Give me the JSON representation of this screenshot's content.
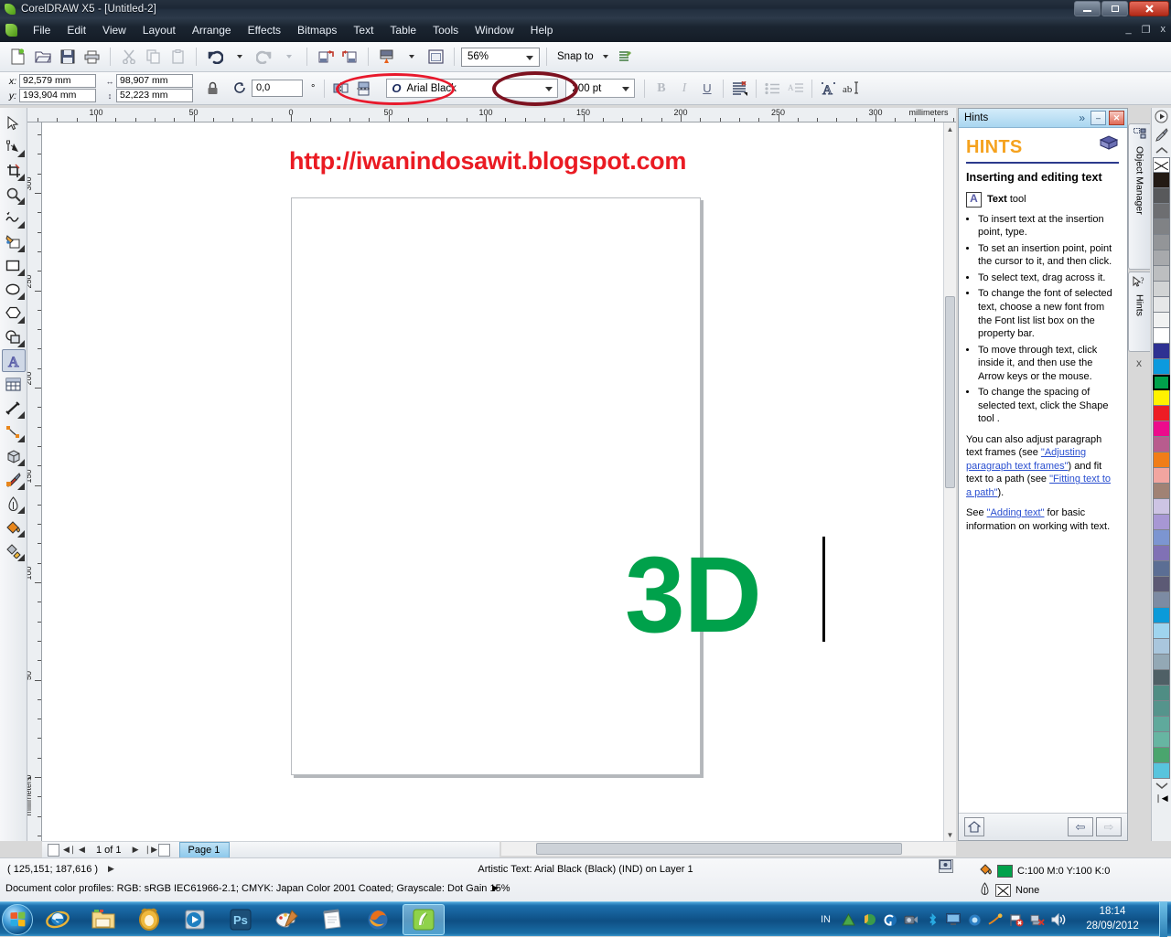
{
  "window": {
    "title": "CorelDRAW X5 - [Untitled-2]",
    "app_icon": "coreldraw-icon",
    "minimize": "minimize-icon",
    "maximize": "maximize-icon",
    "close": "close-icon"
  },
  "menu": {
    "items": [
      "File",
      "Edit",
      "View",
      "Layout",
      "Arrange",
      "Effects",
      "Bitmaps",
      "Text",
      "Table",
      "Tools",
      "Window",
      "Help"
    ],
    "doc_minimize": "_",
    "doc_restore": "❐",
    "doc_close": "x"
  },
  "toolbar": {
    "buttons": [
      {
        "name": "new-document",
        "glyph": "new-icon"
      },
      {
        "name": "open-document",
        "glyph": "open-folder-icon"
      },
      {
        "name": "save-document",
        "glyph": "save-disk-icon"
      },
      {
        "name": "print-document",
        "glyph": "printer-icon"
      },
      {
        "name": "cut",
        "glyph": "scissors-icon"
      },
      {
        "name": "copy",
        "glyph": "copy-icon"
      },
      {
        "name": "paste",
        "glyph": "paste-icon"
      },
      {
        "name": "undo",
        "glyph": "undo-arrow-icon"
      },
      {
        "name": "redo",
        "glyph": "redo-arrow-icon"
      },
      {
        "name": "import",
        "glyph": "import-icon"
      },
      {
        "name": "export",
        "glyph": "export-icon"
      },
      {
        "name": "publish-pdf",
        "glyph": "pdf-icon"
      },
      {
        "name": "application-launcher",
        "glyph": "launcher-icon"
      }
    ],
    "zoom_level": "56%",
    "snap_to_label": "Snap to",
    "options_icon": "options-icon"
  },
  "property_bar": {
    "x_label": "x:",
    "x_value": "92,579 mm",
    "y_label": "y:",
    "y_value": "193,904 mm",
    "width_value": "98,907 mm",
    "height_value": "52,223 mm",
    "lock_icon": "lock-ratio-icon",
    "rotation_value": "0,0",
    "rotation_unit": "°",
    "mirror_h_icon": "mirror-horizontal-icon",
    "mirror_v_icon": "mirror-vertical-icon",
    "font_name": "Arial Black",
    "font_icon": "opentype-icon",
    "font_size": "200 pt",
    "bold": "B",
    "italic": "I",
    "underline": "U",
    "align_icon": "text-align-icon",
    "bullet_list_icon": "bullet-list-icon",
    "drop_cap_icon": "drop-cap-icon",
    "char_format_icon": "character-format-icon",
    "edit_text_icon": "edit-text-icon"
  },
  "annotations": [
    {
      "name": "font-name-highlight-ellipse",
      "color": "#e8192c",
      "target": "Arial Black"
    },
    {
      "name": "font-size-highlight-ellipse",
      "color": "#7d1220",
      "target": "200 pt"
    }
  ],
  "toolbox": {
    "tools": [
      {
        "name": "pick-tool",
        "glyph": "arrow-cursor-icon",
        "selected": false,
        "flyout": false
      },
      {
        "name": "shape-tool",
        "glyph": "node-edit-icon",
        "selected": false,
        "flyout": true
      },
      {
        "name": "crop-tool",
        "glyph": "crop-icon",
        "selected": false,
        "flyout": true
      },
      {
        "name": "zoom-tool",
        "glyph": "magnifier-icon",
        "selected": false,
        "flyout": true
      },
      {
        "name": "freehand-tool",
        "glyph": "freehand-curve-icon",
        "selected": false,
        "flyout": true
      },
      {
        "name": "smart-fill-tool",
        "glyph": "smart-fill-icon",
        "selected": false,
        "flyout": true
      },
      {
        "name": "rectangle-tool",
        "glyph": "rectangle-icon",
        "selected": false,
        "flyout": true
      },
      {
        "name": "ellipse-tool",
        "glyph": "ellipse-icon",
        "selected": false,
        "flyout": true
      },
      {
        "name": "polygon-tool",
        "glyph": "polygon-icon",
        "selected": false,
        "flyout": true
      },
      {
        "name": "basic-shapes-tool",
        "glyph": "basic-shapes-icon",
        "selected": false,
        "flyout": true
      },
      {
        "name": "text-tool",
        "glyph": "letter-a-icon",
        "selected": true,
        "flyout": false
      },
      {
        "name": "table-tool",
        "glyph": "table-grid-icon",
        "selected": false,
        "flyout": false
      },
      {
        "name": "dimension-tool",
        "glyph": "dimension-icon",
        "selected": false,
        "flyout": true
      },
      {
        "name": "connector-tool",
        "glyph": "connector-line-icon",
        "selected": false,
        "flyout": true
      },
      {
        "name": "extrude-tool",
        "glyph": "cube-extrude-icon",
        "selected": false,
        "flyout": true
      },
      {
        "name": "color-eyedropper-tool",
        "glyph": "eyedropper-icon",
        "selected": false,
        "flyout": true
      },
      {
        "name": "outline-tool",
        "glyph": "pen-nib-icon",
        "selected": false,
        "flyout": true
      },
      {
        "name": "fill-tool",
        "glyph": "paint-bucket-icon",
        "selected": false,
        "flyout": true
      },
      {
        "name": "interactive-fill-tool",
        "glyph": "interactive-fill-icon",
        "selected": false,
        "flyout": true
      }
    ]
  },
  "rulers": {
    "unit_label": "millimeters",
    "horizontal_ticks": [
      "100",
      "50",
      "0",
      "50",
      "100",
      "150",
      "200",
      "250",
      "300"
    ],
    "vertical_ticks": [
      "300",
      "250",
      "200",
      "150",
      "100",
      "50",
      "0"
    ]
  },
  "canvas": {
    "overlay_url": "http://iwanindosawit.blogspot.com",
    "overlay_url_color": "#ea1b23",
    "artistic_text": "3D",
    "artistic_text_color": "#00a14b",
    "cursor": "text-caret"
  },
  "page_nav": {
    "add_page_start_icon": "add-page-icon",
    "first_icon": "◀❘",
    "prev_icon": "◀",
    "counter": "1 of 1",
    "next_icon": "▶",
    "last_icon": "❘▶",
    "add_page_end_icon": "add-page-icon",
    "page_tab": "Page 1"
  },
  "docker": {
    "title": "Hints",
    "expand_icon": "»",
    "minimize_icon": "–",
    "close_icon": "✕",
    "heading": "HINTS",
    "heading_color": "#f5a21e",
    "book_icon": "book-icon",
    "subheading": "Inserting and editing text",
    "tool_box_glyph": "A",
    "tool_name": "Text",
    "tool_suffix": " tool",
    "bullets": [
      "To insert text at the insertion point, type.",
      "To set an insertion point, point the cursor to it, and then click.",
      "To select text, drag across it.",
      "To change the font of selected text, choose a new font from the Font list list box on the property bar.",
      "To move through text, click inside it, and then use the Arrow keys or the mouse.",
      "To change the spacing of selected text, click the Shape tool ."
    ],
    "paragraph_1_pre": "You can also adjust paragraph text frames (see ",
    "paragraph_1_link1": "\"Adjusting paragraph text frames\"",
    "paragraph_1_mid": ") and fit text to a path (see ",
    "paragraph_1_link2": "\"Fitting text to a path\"",
    "paragraph_1_end": ").",
    "paragraph_2_pre": "See ",
    "paragraph_2_link": "\"Adding text\"",
    "paragraph_2_end": " for basic information on working with text.",
    "home_icon": "home-icon",
    "back_icon": "⇦",
    "forward_icon": "⇨",
    "tabs": [
      "Object Manager",
      "Hints"
    ],
    "tab_close": "x"
  },
  "status_bar": {
    "coordinates": "( 125,151; 187,616 )",
    "coord_arrow": "▶",
    "object_info": "Artistic Text: Arial Black (Black) (IND) on Layer 1",
    "color_profiles": "Document color profiles: RGB: sRGB IEC61966-2.1; CMYK: Japan Color 2001 Coated; Grayscale: Dot Gain 15%",
    "profiles_arrow": "▶",
    "fill_icon": "paint-bucket-icon",
    "fill_swatch_color": "#00a14b",
    "fill_value": "C:100 M:0 Y:100 K:0",
    "outline_icon": "pen-nib-icon",
    "outline_value": "None",
    "screen_icon": "screen-icon"
  },
  "palette": {
    "top_icons": [
      "play-icon",
      "eyedropper-icon",
      "scroll-up-icon"
    ],
    "scroll_down_icon": "▼",
    "expand_icon": "❘◀",
    "swatches": [
      {
        "color": "none",
        "name": "no-color",
        "selected": false
      },
      {
        "color": "#231a14",
        "name": "black",
        "selected": false
      },
      {
        "color": "#58595b",
        "name": "dark-gray-90",
        "selected": false
      },
      {
        "color": "#6d6e71",
        "name": "dark-gray-80",
        "selected": false
      },
      {
        "color": "#808285",
        "name": "gray-70",
        "selected": false
      },
      {
        "color": "#939598",
        "name": "gray-60",
        "selected": false
      },
      {
        "color": "#a7a9ac",
        "name": "gray-50",
        "selected": false
      },
      {
        "color": "#bcbec0",
        "name": "gray-40",
        "selected": false
      },
      {
        "color": "#d1d3d4",
        "name": "gray-30",
        "selected": false
      },
      {
        "color": "#e6e7e8",
        "name": "gray-20",
        "selected": false
      },
      {
        "color": "#f1f2f2",
        "name": "gray-10",
        "selected": false
      },
      {
        "color": "#ffffff",
        "name": "white",
        "selected": false
      },
      {
        "color": "#2e3192",
        "name": "dark-blue",
        "selected": false
      },
      {
        "color": "#0c9ade",
        "name": "cyan-blue",
        "selected": false
      },
      {
        "color": "#00a14b",
        "name": "green",
        "selected": true
      },
      {
        "color": "#fff200",
        "name": "yellow",
        "selected": false
      },
      {
        "color": "#ed1c24",
        "name": "red",
        "selected": false
      },
      {
        "color": "#ec0b8c",
        "name": "magenta",
        "selected": false
      },
      {
        "color": "#b85c8e",
        "name": "mauve",
        "selected": false
      },
      {
        "color": "#f07d18",
        "name": "orange",
        "selected": false
      },
      {
        "color": "#f2a5a0",
        "name": "light-pink",
        "selected": false
      },
      {
        "color": "#a08275",
        "name": "taupe",
        "selected": false
      },
      {
        "color": "#cdc4e4",
        "name": "pale-violet",
        "selected": false
      },
      {
        "color": "#a797d4",
        "name": "light-violet",
        "selected": false
      },
      {
        "color": "#7c95d1",
        "name": "periwinkle",
        "selected": false
      },
      {
        "color": "#8071b5",
        "name": "violet",
        "selected": false
      },
      {
        "color": "#5b6e94",
        "name": "slate-blue",
        "selected": false
      },
      {
        "color": "#5c5a75",
        "name": "dark-slate",
        "selected": false
      },
      {
        "color": "#7c8ba3",
        "name": "blue-gray",
        "selected": false
      },
      {
        "color": "#0b9ad9",
        "name": "sky-blue",
        "selected": false
      },
      {
        "color": "#9fd4ee",
        "name": "pale-blue",
        "selected": false
      },
      {
        "color": "#a9c6dd",
        "name": "powder-blue",
        "selected": false
      },
      {
        "color": "#93a8b5",
        "name": "steel-blue",
        "selected": false
      },
      {
        "color": "#4f6066",
        "name": "dark-teal-gray",
        "selected": false
      },
      {
        "color": "#4f8d84",
        "name": "teal",
        "selected": false
      },
      {
        "color": "#55948c",
        "name": "sea-green",
        "selected": false
      },
      {
        "color": "#5fa99c",
        "name": "light-teal",
        "selected": false
      },
      {
        "color": "#67b5a2",
        "name": "mint",
        "selected": false
      },
      {
        "color": "#4aa56e",
        "name": "medium-green",
        "selected": false
      },
      {
        "color": "#58c4dd",
        "name": "aqua",
        "selected": false
      }
    ]
  },
  "taskbar": {
    "start_button": "start-orb",
    "items": [
      {
        "name": "internet-explorer",
        "active": false
      },
      {
        "name": "windows-explorer",
        "active": false
      },
      {
        "name": "media-app",
        "active": false
      },
      {
        "name": "media-player",
        "active": false
      },
      {
        "name": "photoshop",
        "active": false
      },
      {
        "name": "paint",
        "active": false
      },
      {
        "name": "notepad",
        "active": false
      },
      {
        "name": "firefox",
        "active": false
      },
      {
        "name": "coreldraw",
        "active": true
      }
    ],
    "language": "IN",
    "tray_icons": [
      "triangle-icon",
      "shield-globe-icon",
      "circle-c-icon",
      "camera-icon",
      "bluetooth-icon",
      "monitor-icon",
      "blue-circle-icon",
      "comet-icon",
      "flag-error-icon",
      "network-error-icon",
      "volume-icon"
    ],
    "time": "18:14",
    "date": "28/09/2012"
  }
}
